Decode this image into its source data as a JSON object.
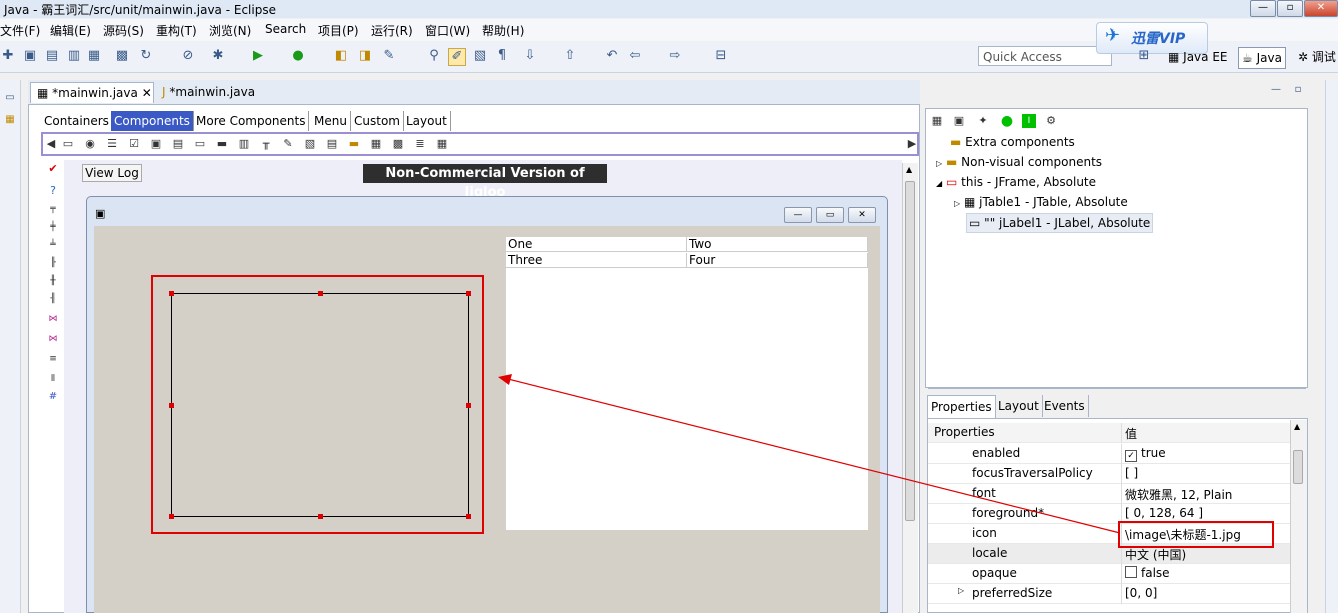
{
  "window": {
    "title": "Java  -  霸王词汇/src/unit/mainwin.java  -  Eclipse"
  },
  "menu": [
    "文件(F)",
    "编辑(E)",
    "源码(S)",
    "重构(T)",
    "浏览(N)",
    "Search",
    "项目(P)",
    "运行(R)",
    "窗口(W)",
    "帮助(H)"
  ],
  "toolbar": {
    "quick_access_placeholder": "Quick Access",
    "xunlei": "迅雷VIP",
    "perspectives": [
      "Java EE",
      "Java",
      "调试"
    ]
  },
  "editor_tabs": [
    {
      "label": "*mainwin.java",
      "active": true
    },
    {
      "label": "*mainwin.java",
      "active": false
    }
  ],
  "palette_tabs": [
    "Containers",
    "Components",
    "More Components",
    "Menu",
    "Custom",
    "Layout"
  ],
  "palette_active": "Components",
  "form": {
    "view_log": "View Log",
    "banner": "Non-Commercial Version of Jigloo",
    "table_rows": [
      [
        "One",
        "Two"
      ],
      [
        "Three",
        "Four"
      ]
    ]
  },
  "outline": {
    "items": [
      {
        "label": "Extra components",
        "level": 1
      },
      {
        "label": "Non-visual components",
        "level": 1
      },
      {
        "label": "this - JFrame, Absolute",
        "level": 1
      },
      {
        "label": "jTable1 - JTable, Absolute",
        "level": 2
      },
      {
        "label": "\"\" jLabel1 - JLabel, Absolute",
        "level": 2
      }
    ]
  },
  "properties": {
    "tabs": [
      "Properties",
      "Layout",
      "Events"
    ],
    "header": {
      "name": "Properties",
      "value": "值"
    },
    "rows": [
      {
        "name": "enabled",
        "value": "true",
        "checkbox": true,
        "checked": true
      },
      {
        "name": "focusTraversalPolicy",
        "value": "[ ]"
      },
      {
        "name": "font",
        "value": "微软雅黑, 12, Plain"
      },
      {
        "name": "foreground*",
        "value": "[ 0, 128, 64 ]"
      },
      {
        "name": "icon",
        "value": "\\image\\未标题-1.jpg"
      },
      {
        "name": "locale",
        "value": "中文 (中国)"
      },
      {
        "name": "opaque",
        "value": "false",
        "checkbox": true,
        "checked": false
      },
      {
        "name": "preferredSize",
        "value": "[0, 0]"
      }
    ]
  },
  "colors": {
    "annotation": "#e00000",
    "palette_active": "#3b59c5"
  }
}
